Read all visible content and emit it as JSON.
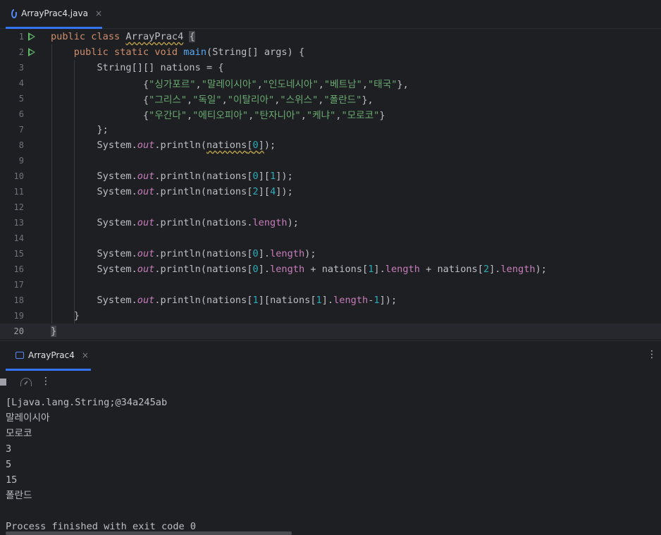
{
  "editor_tab": {
    "filename": "ArrayPrac4.java",
    "close": "×"
  },
  "gutter": [
    "1",
    "2",
    "3",
    "4",
    "5",
    "6",
    "7",
    "8",
    "9",
    "10",
    "11",
    "12",
    "13",
    "14",
    "15",
    "16",
    "17",
    "18",
    "19",
    "20"
  ],
  "code": {
    "l1": [
      "public",
      "class",
      "ArrayPrac4",
      "{"
    ],
    "l2": [
      "public",
      "static",
      "void",
      "main",
      "(String[] args) {"
    ],
    "l3": "String[][] nations = {",
    "l4": [
      "{",
      "\"싱가포르\"",
      ",",
      "\"말레이시아\"",
      ",",
      "\"인도네시아\"",
      ",",
      "\"베트남\"",
      ",",
      "\"태국\"",
      "},"
    ],
    "l5": [
      "{",
      "\"그리스\"",
      ",",
      "\"독일\"",
      ",",
      "\"이탈리아\"",
      ",",
      "\"스위스\"",
      ",",
      "\"폴란드\"",
      "},"
    ],
    "l6": [
      "{",
      "\"우간다\"",
      ",",
      "\"에티오피아\"",
      ",",
      "\"탄자니아\"",
      ",",
      "\"케냐\"",
      ",",
      "\"모로코\"",
      "}"
    ],
    "l7": "};",
    "system": "System.",
    "out": "out",
    "println": ".println(",
    "nations": "nations",
    "length": "length",
    "l8_idx": "0",
    "l10_a": "0",
    "l10_b": "1",
    "l11_a": "2",
    "l11_b": "4",
    "l16_a": "0",
    "l16_b": "1",
    "l16_c": "2",
    "l18_a": "1",
    "l18_b": "1",
    "l18_c": "1",
    "l19": "}",
    "l20": "}"
  },
  "run_tab": {
    "label": "ArrayPrac4",
    "close": "×"
  },
  "more_icon": "⋮",
  "console_output": [
    "[Ljava.lang.String;@34a245ab",
    "말레이시아",
    "모로코",
    "3",
    "5",
    "15",
    "폴란드",
    "",
    "Process finished with exit code 0"
  ],
  "colors": {
    "background": "#1e1f22",
    "keyword": "#cf8e6d",
    "string": "#6aab73",
    "number": "#2aacb8",
    "field": "#c77dbb",
    "method": "#56a8f5",
    "accent": "#3574f0"
  }
}
